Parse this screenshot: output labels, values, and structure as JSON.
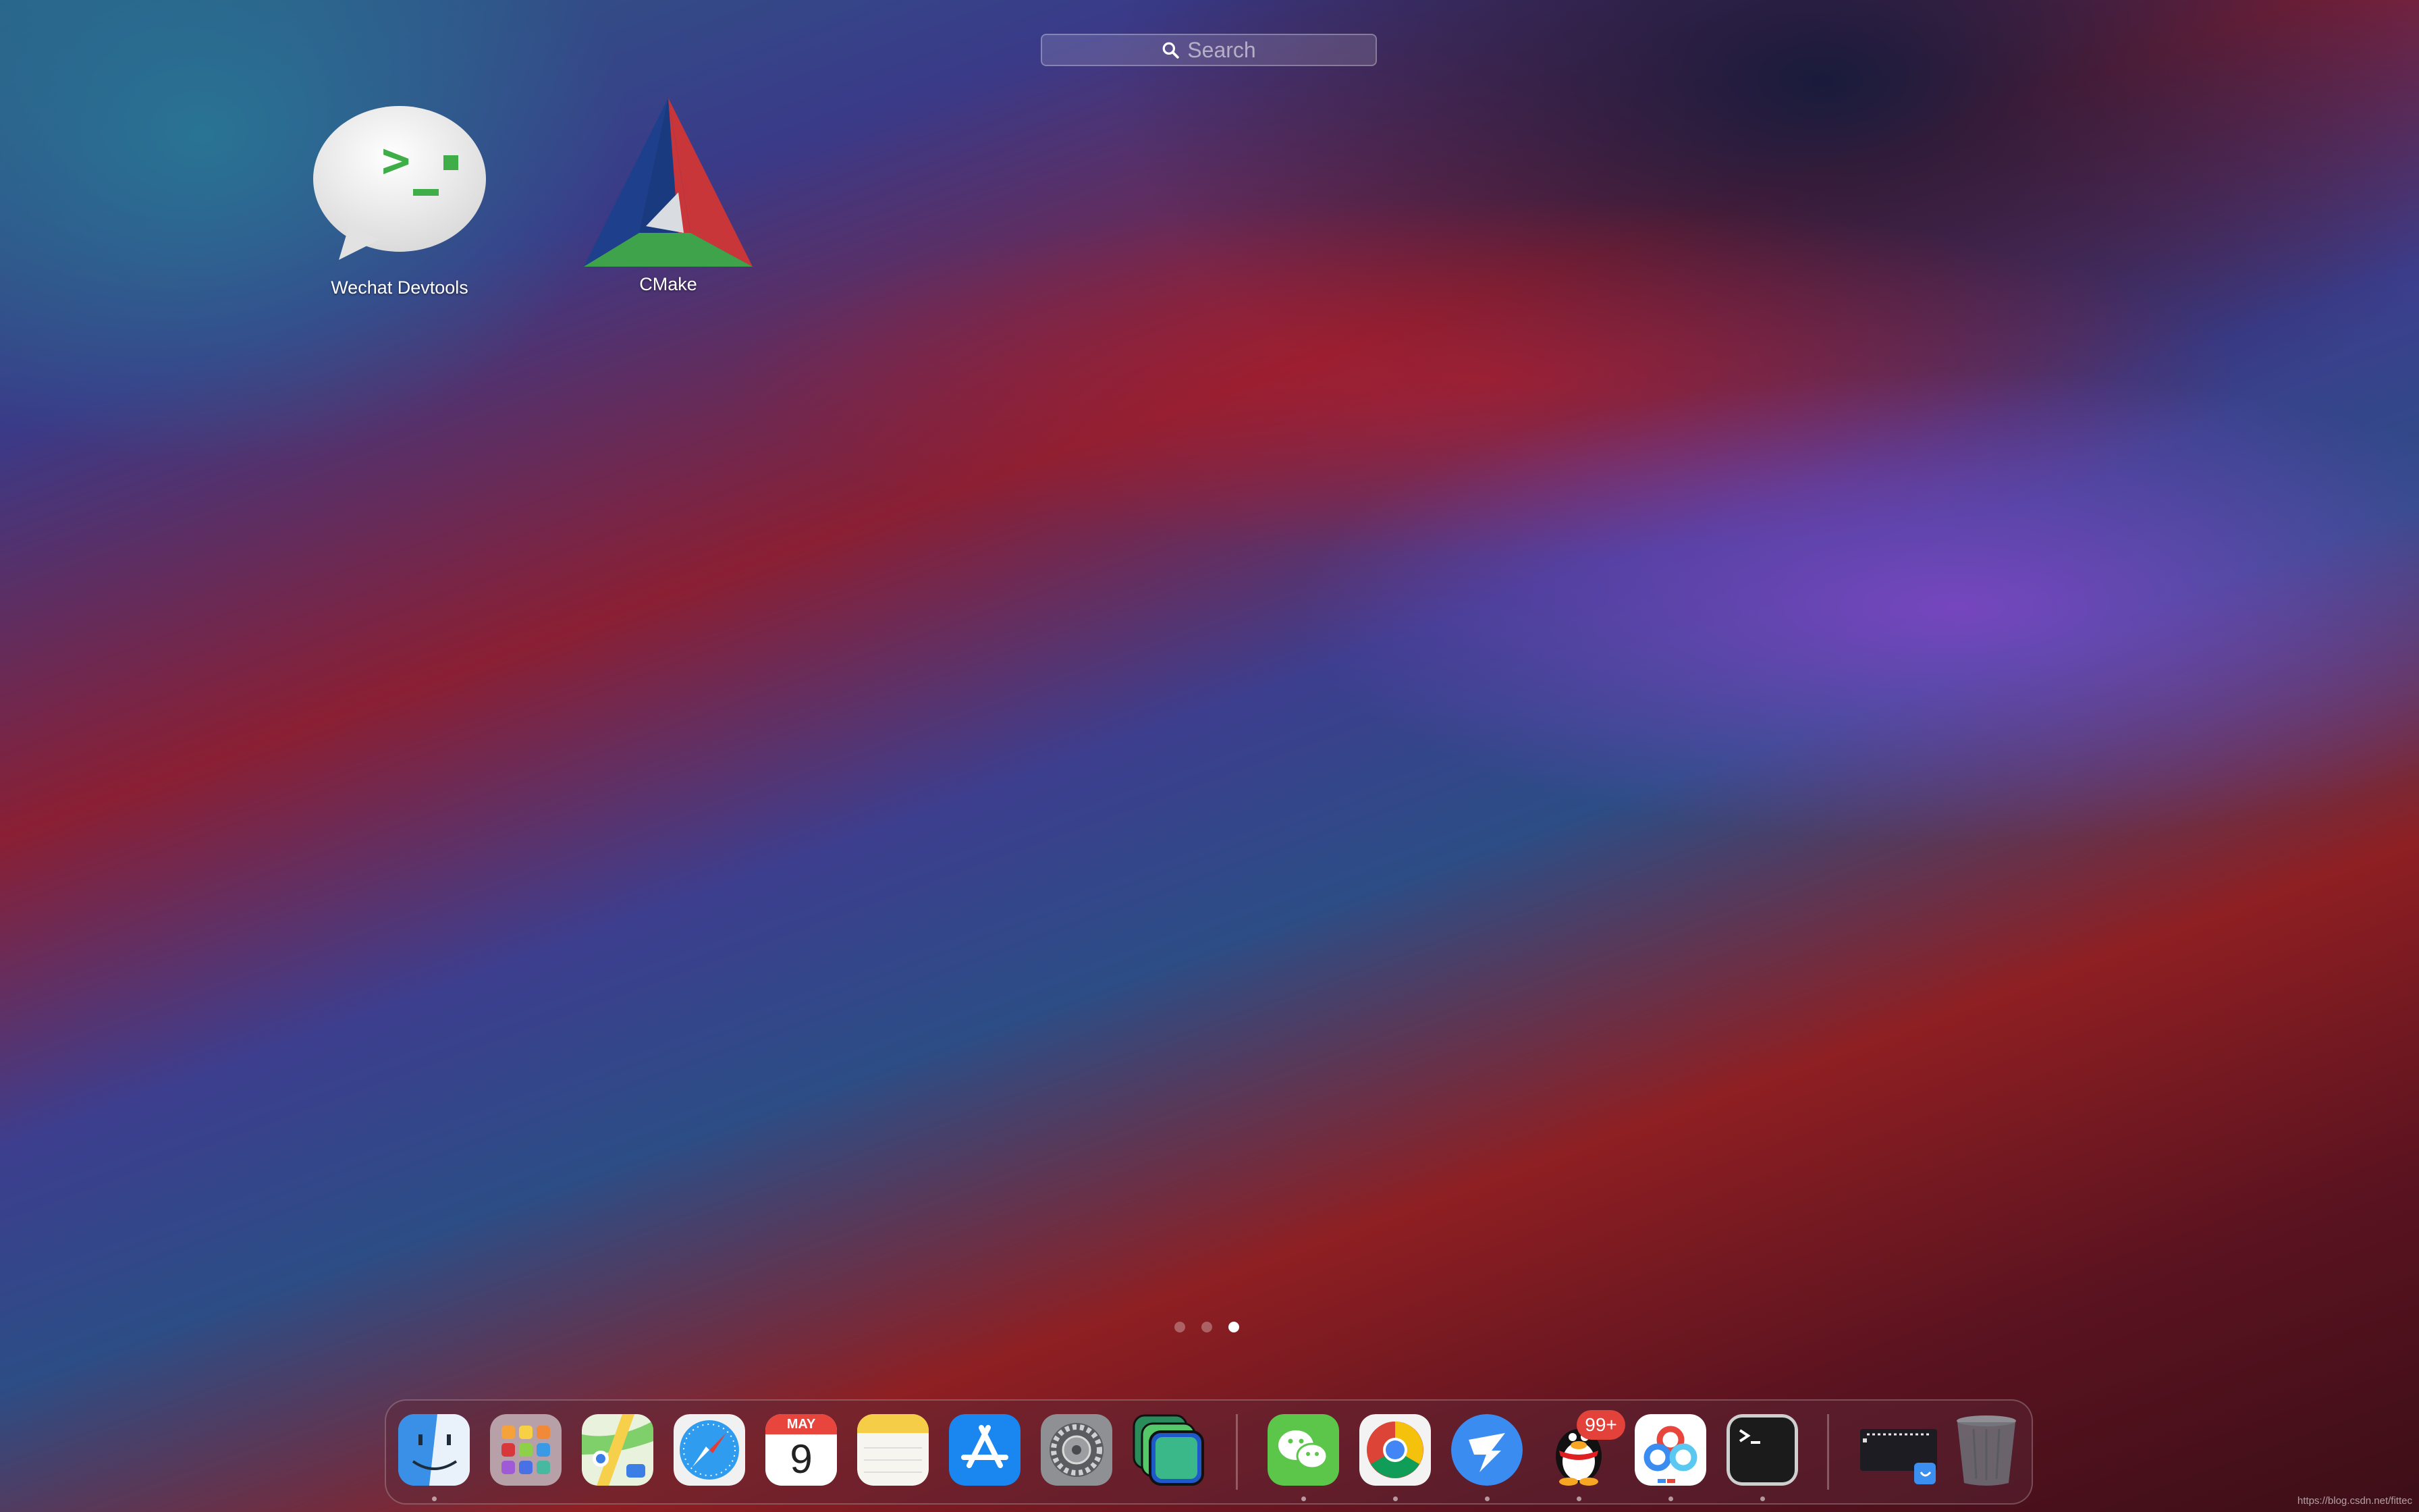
{
  "search": {
    "placeholder": "Search",
    "icon": "search-icon"
  },
  "apps": [
    {
      "label": "Wechat Devtools",
      "icon": "wechat-devtools-icon"
    },
    {
      "label": "CMake",
      "icon": "cmake-icon"
    }
  ],
  "pages": {
    "count": 3,
    "current": 3
  },
  "dock": {
    "items": [
      {
        "name": "finder",
        "running": true
      },
      {
        "name": "launchpad",
        "running": false
      },
      {
        "name": "maps",
        "running": false
      },
      {
        "name": "safari",
        "running": false
      },
      {
        "name": "calendar",
        "month": "MAY",
        "day": "9",
        "running": false
      },
      {
        "name": "notes",
        "running": false
      },
      {
        "name": "app-store",
        "running": false
      },
      {
        "name": "system-preferences",
        "running": false
      },
      {
        "name": "screens",
        "running": false
      },
      {
        "name": "wechat",
        "running": true
      },
      {
        "name": "chrome",
        "running": true
      },
      {
        "name": "dingtalk",
        "running": true
      },
      {
        "name": "qq",
        "badge": "99+",
        "running": true
      },
      {
        "name": "baidu-netdisk",
        "running": true
      },
      {
        "name": "terminal",
        "running": true
      },
      {
        "name": "downloads-folder",
        "running": false
      },
      {
        "name": "trash",
        "running": false
      }
    ]
  },
  "watermark": "https://blog.csdn.net/fittec"
}
